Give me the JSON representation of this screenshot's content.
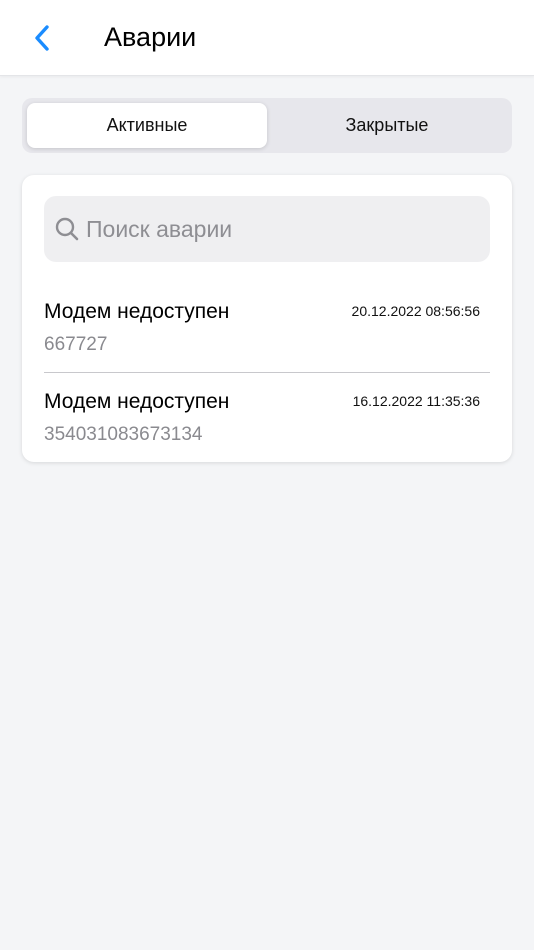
{
  "header": {
    "title": "Аварии",
    "back_icon": "chevron-left-icon",
    "accent_color": "#1a8cff"
  },
  "tabs": [
    {
      "label": "Активные",
      "selected": true
    },
    {
      "label": "Закрытые",
      "selected": false
    }
  ],
  "search": {
    "icon": "search-icon",
    "placeholder": "Поиск аварии",
    "value": ""
  },
  "alarms": [
    {
      "title": "Модем недоступен",
      "datetime": "20.12.2022 08:56:56",
      "id": "667727"
    },
    {
      "title": "Модем недоступен",
      "datetime": "16.12.2022 11:35:36",
      "id": "354031083673134"
    }
  ]
}
